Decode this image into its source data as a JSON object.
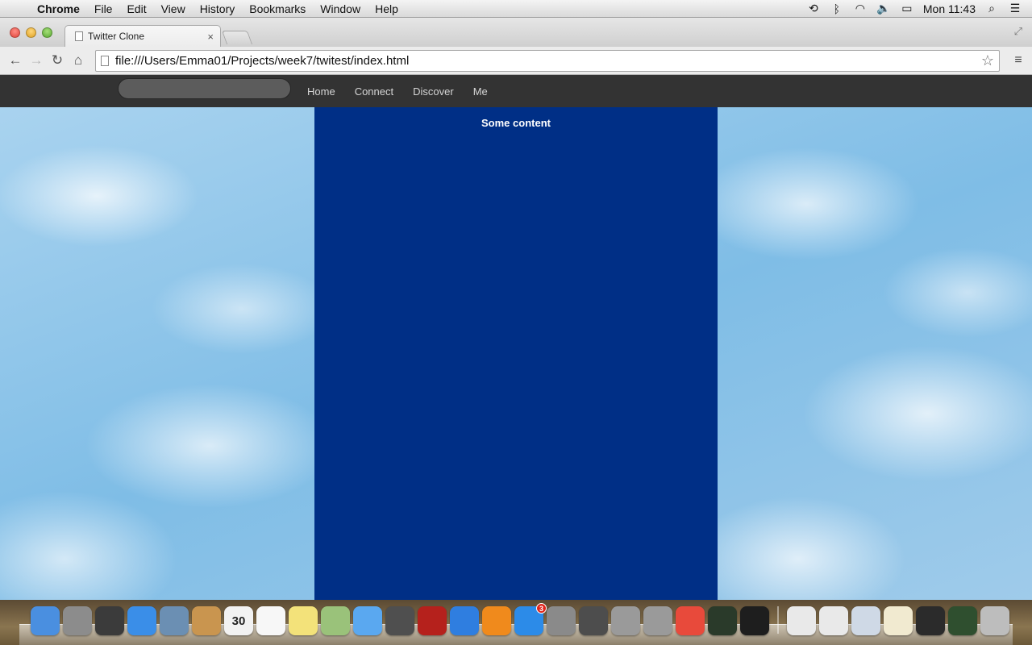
{
  "menubar": {
    "app_name": "Chrome",
    "items": [
      "File",
      "Edit",
      "View",
      "History",
      "Bookmarks",
      "Window",
      "Help"
    ],
    "clock": "Mon 11:43",
    "status_icons": [
      "time-machine-icon",
      "bluetooth-icon",
      "wifi-icon",
      "volume-icon",
      "battery-icon",
      "spotlight-icon",
      "notification-center-icon"
    ]
  },
  "browser": {
    "tab_title": "Twitter Clone",
    "tab_close": "×",
    "url": "file:///Users/Emma01/Projects/week7/twitest/index.html"
  },
  "site": {
    "search_placeholder": "",
    "nav_links": [
      "Home",
      "Connect",
      "Discover",
      "Me"
    ],
    "main_text": "Some content",
    "column_color": "#002f86",
    "nav_color": "#333333"
  },
  "dock": {
    "calendar_day": "30",
    "app_store_badge": "3",
    "apps": [
      {
        "name": "finder",
        "color": "#4a8fe0"
      },
      {
        "name": "launchpad",
        "color": "#8c8c8c"
      },
      {
        "name": "photo-booth",
        "color": "#3b3b3b"
      },
      {
        "name": "safari",
        "color": "#3a8ee8"
      },
      {
        "name": "mail",
        "color": "#6b8fb3"
      },
      {
        "name": "contacts",
        "color": "#c9954f"
      },
      {
        "name": "calendar",
        "color": "#f2f2f2"
      },
      {
        "name": "reminders",
        "color": "#f7f7f7"
      },
      {
        "name": "notes",
        "color": "#f3e27a"
      },
      {
        "name": "maps",
        "color": "#9ac27a"
      },
      {
        "name": "messages",
        "color": "#5aa8f0"
      },
      {
        "name": "facetime",
        "color": "#4f4f4f"
      },
      {
        "name": "photo-booth-red",
        "color": "#b5211c"
      },
      {
        "name": "itunes",
        "color": "#2f7ee0"
      },
      {
        "name": "ibooks",
        "color": "#f08a1c"
      },
      {
        "name": "app-store",
        "color": "#2c8be8"
      },
      {
        "name": "system-preferences",
        "color": "#8a8a8a"
      },
      {
        "name": "sublime-text",
        "color": "#4d4d4d"
      },
      {
        "name": "unknown-app-1",
        "color": "#9a9a9a"
      },
      {
        "name": "unknown-app-2",
        "color": "#9a9a9a"
      },
      {
        "name": "chrome",
        "color": "#e84a3b"
      },
      {
        "name": "activity-monitor",
        "color": "#2a3a2a"
      },
      {
        "name": "terminal",
        "color": "#1e1e1e"
      }
    ],
    "stacks": [
      {
        "name": "document-stack-1",
        "color": "#e9e9e9"
      },
      {
        "name": "document-stack-2",
        "color": "#e9e9e9"
      },
      {
        "name": "screenshot-stack-1",
        "color": "#cfd9e6"
      },
      {
        "name": "screenshot-stack-2",
        "color": "#f1ead0"
      },
      {
        "name": "screenshot-stack-3",
        "color": "#2b2b2b"
      },
      {
        "name": "screenshot-stack-4",
        "color": "#2f4f2f"
      },
      {
        "name": "trash",
        "color": "#bdbdbd"
      }
    ]
  }
}
